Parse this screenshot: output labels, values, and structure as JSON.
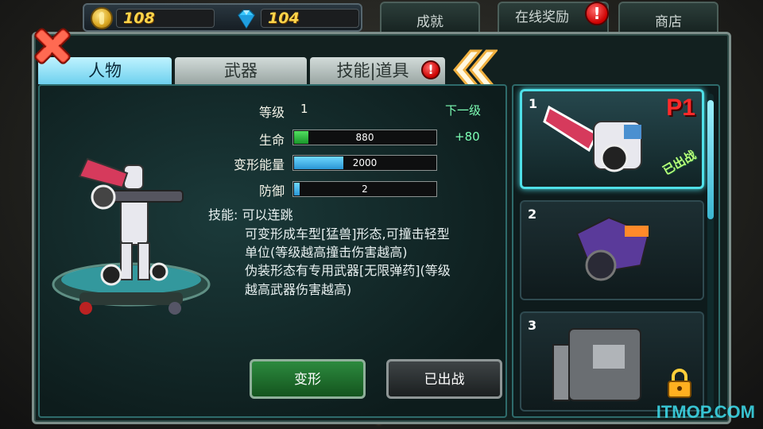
{
  "currency": {
    "coins": "108",
    "gems": "104"
  },
  "top_tabs": {
    "achievements": "成就",
    "online_rewards": "在线奖励",
    "shop": "商店",
    "alert_mark": "!"
  },
  "tabs": {
    "character": "人物",
    "weapon": "武器",
    "skills_items": "技能|道具",
    "alert_mark": "!"
  },
  "stats": {
    "level_label": "等级",
    "level_value": "1",
    "next_level_label": "下一级",
    "hp_label": "生命",
    "hp_value": "880",
    "hp_next": "+80",
    "hp_fill": 0.1,
    "transform_label": "变形能量",
    "transform_value": "2000",
    "transform_fill": 0.35,
    "defense_label": "防御",
    "defense_value": "2",
    "defense_fill": 0.04
  },
  "skill": {
    "line1": "技能: 可以连跳",
    "line2": "可变形成车型[猛兽]形态,可撞击轻型",
    "line3": "单位(等级越高撞击伤害越高)",
    "line4": "伪装形态有专用武器[无限弹药](等级",
    "line5": "越高武器伤害越高)"
  },
  "buttons": {
    "transform": "变形",
    "deployed": "已出战"
  },
  "characters": [
    {
      "index": "1",
      "player_tag": "P1",
      "status": "已出战"
    },
    {
      "index": "2"
    },
    {
      "index": "3"
    }
  ],
  "watermark": "ITMOP.COM",
  "colors": {
    "hp": "#27c53a",
    "energy": "#3bb7f0",
    "defense": "#3bb7f0",
    "accent": "#4fe0e8",
    "player_tag": "#ff2a2a"
  }
}
